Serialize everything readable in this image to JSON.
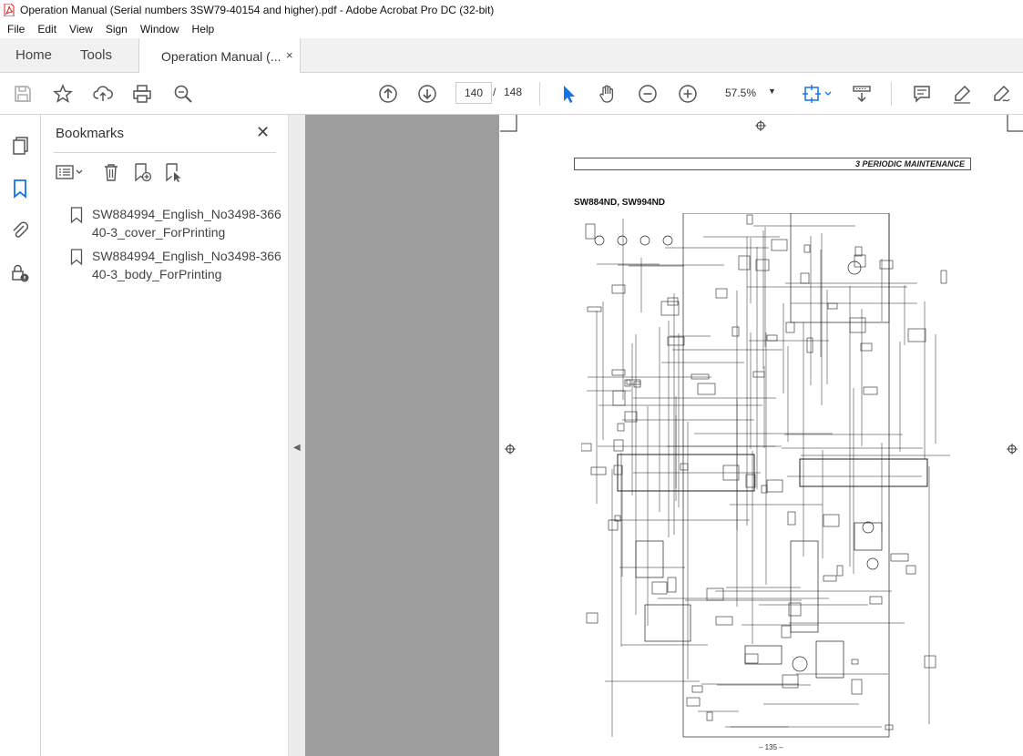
{
  "window": {
    "title": "Operation Manual (Serial numbers 3SW79-40154 and higher).pdf - Adobe Acrobat Pro DC (32-bit)"
  },
  "menu": [
    "File",
    "Edit",
    "View",
    "Sign",
    "Window",
    "Help"
  ],
  "tabs": {
    "home": "Home",
    "tools": "Tools",
    "document": "Operation Manual (...",
    "close": "×"
  },
  "toolbar": {
    "current_page": "140",
    "separator": "/",
    "total_pages": "148",
    "zoom": "57.5%"
  },
  "bookmarks": {
    "title": "Bookmarks",
    "close": "✕",
    "items": [
      {
        "label": "SW884994_English_No3498-36640-3_cover_ForPrinting"
      },
      {
        "label": "SW884994_English_No3498-36640-3_body_ForPrinting"
      }
    ]
  },
  "document_page": {
    "section_header": "3  PERIODIC MAINTENANCE",
    "model_title": "SW884ND, SW994ND",
    "page_number": "– 135 –"
  },
  "icons": {
    "save": "save-icon",
    "bookmark_star": "star-icon",
    "upload": "cloud-upload-icon",
    "print": "print-icon",
    "zoom_search": "zoom-search-icon",
    "prev": "page-up-icon",
    "next": "page-down-icon",
    "select": "cursor-icon",
    "hand": "hand-icon",
    "zoom_out": "zoom-out-icon",
    "zoom_in": "zoom-in-icon",
    "fit": "fit-page-icon",
    "scroll": "scroll-mode-icon",
    "comment": "comment-icon",
    "highlight": "highlight-icon",
    "sign": "sign-icon"
  },
  "colors": {
    "accent": "#1473e6",
    "pdf_red": "#d7232a",
    "viewer_bg": "#9e9e9e"
  }
}
